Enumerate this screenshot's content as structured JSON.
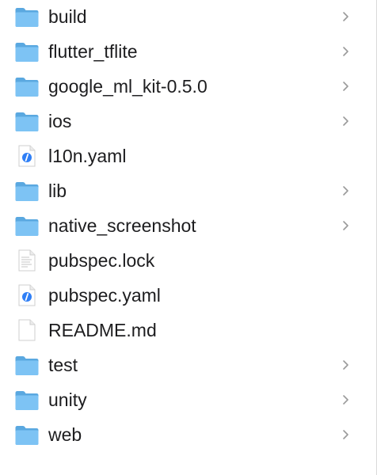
{
  "colors": {
    "folder_back": "#5aa8e0",
    "folder_front": "#7dc3f4",
    "chevron": "#9a9a9a",
    "text": "#1d1d1f"
  },
  "items": [
    {
      "name": "build",
      "type": "folder",
      "icon": "folder-icon"
    },
    {
      "name": "flutter_tflite",
      "type": "folder",
      "icon": "folder-icon"
    },
    {
      "name": "google_ml_kit-0.5.0",
      "type": "folder",
      "icon": "folder-icon"
    },
    {
      "name": "ios",
      "type": "folder",
      "icon": "folder-icon"
    },
    {
      "name": "l10n.yaml",
      "type": "yaml",
      "icon": "yaml-file-icon"
    },
    {
      "name": "lib",
      "type": "folder",
      "icon": "folder-icon"
    },
    {
      "name": "native_screenshot",
      "type": "folder",
      "icon": "folder-icon"
    },
    {
      "name": "pubspec.lock",
      "type": "text",
      "icon": "text-file-icon"
    },
    {
      "name": "pubspec.yaml",
      "type": "yaml",
      "icon": "yaml-file-icon"
    },
    {
      "name": "README.md",
      "type": "blank",
      "icon": "document-file-icon"
    },
    {
      "name": "test",
      "type": "folder",
      "icon": "folder-icon"
    },
    {
      "name": "unity",
      "type": "folder",
      "icon": "folder-icon"
    },
    {
      "name": "web",
      "type": "folder",
      "icon": "folder-icon"
    }
  ]
}
